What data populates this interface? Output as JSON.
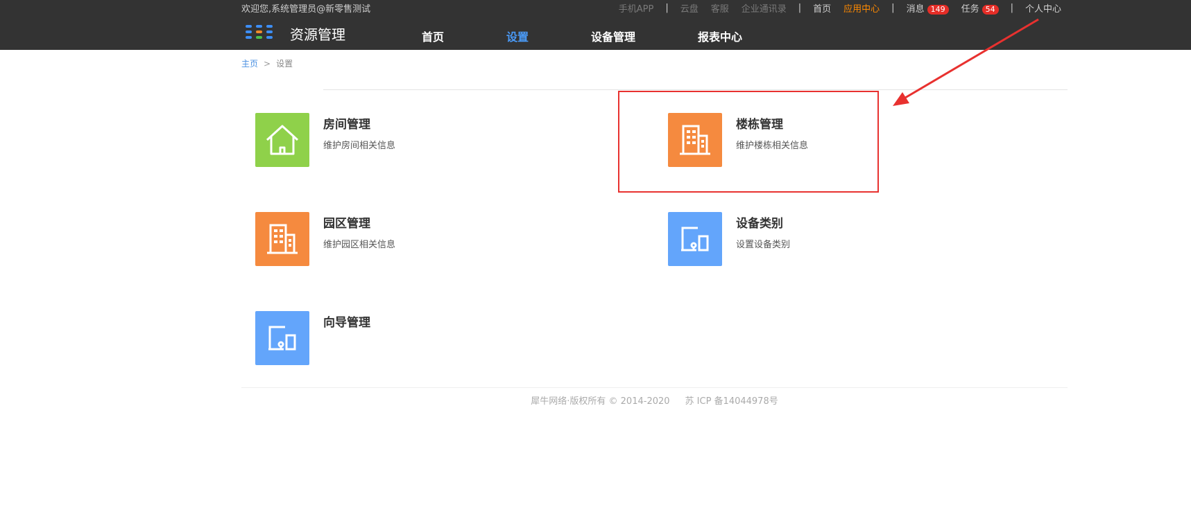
{
  "topbar": {
    "welcome": "欢迎您,系统管理员@新零售测试",
    "links": {
      "mobile_app": "手机APP",
      "cloud": "云盘",
      "service": "客服",
      "contacts": "企业通讯录",
      "home": "首页",
      "app_center": "应用中心",
      "messages": "消息",
      "messages_count": "149",
      "tasks": "任务",
      "tasks_count": "54",
      "personal": "个人中心"
    },
    "separator": "|"
  },
  "header": {
    "brand": "资源管理",
    "nav": [
      {
        "label": "首页",
        "active": false
      },
      {
        "label": "设置",
        "active": true
      },
      {
        "label": "设备管理",
        "active": false
      },
      {
        "label": "报表中心",
        "active": false
      }
    ]
  },
  "breadcrumb": {
    "home": "主页",
    "sep": ">",
    "current": "设置"
  },
  "cards": [
    {
      "title": "房间管理",
      "desc": "维护房间相关信息",
      "icon": "house-icon",
      "color": "#8fd14a"
    },
    {
      "title": "楼栋管理",
      "desc": "维护楼栋相关信息",
      "icon": "building-icon",
      "color": "#f58a3f"
    },
    {
      "title": "园区管理",
      "desc": "维护园区相关信息",
      "icon": "building-icon",
      "color": "#f58a3f"
    },
    {
      "title": "设备类别",
      "desc": "设置设备类别",
      "icon": "devices-icon",
      "color": "#63a5fb"
    },
    {
      "title": "向导管理",
      "desc": "",
      "icon": "devices-icon",
      "color": "#63a5fb"
    }
  ],
  "footer": {
    "copyright": "犀牛网络·版权所有 © 2014-2020",
    "icp": "苏 ICP 备14044978号"
  },
  "colors": {
    "topbar_bg": "#333333",
    "accent_blue": "#4a9af7",
    "orange": "#ff8a00",
    "badge_red": "#e52d27",
    "highlight_red": "#e8312f"
  }
}
